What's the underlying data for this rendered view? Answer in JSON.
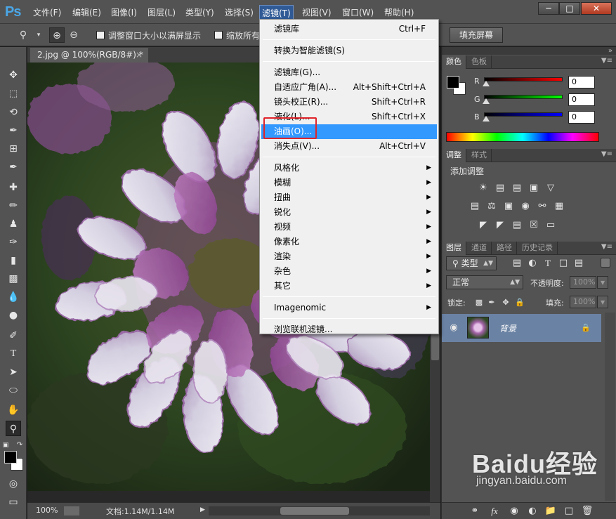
{
  "app": {
    "logo": "Ps"
  },
  "menubar": {
    "items": [
      "文件(F)",
      "编辑(E)",
      "图像(I)",
      "图层(L)",
      "类型(Y)",
      "选择(S)",
      "滤镜(T)",
      "视图(V)",
      "窗口(W)",
      "帮助(H)"
    ],
    "active": "滤镜(T)"
  },
  "window_controls": {
    "minimize": "─",
    "restore": "□",
    "close": "✕"
  },
  "options": {
    "resize_windows_label": "调整窗口大小以满屏显示",
    "zoom_all_label": "缩放所有",
    "fill_screen_label": "填充屏幕"
  },
  "document": {
    "tab_title": "2.jpg @ 100%(RGB/8#) *",
    "tab_close": "×",
    "zoom": "100%",
    "doc_size": "文档:1.14M/1.14M"
  },
  "filter_menu": {
    "items": [
      {
        "label": "滤镜库",
        "shortcut": "Ctrl+F"
      },
      {
        "separator": true
      },
      {
        "label": "转换为智能滤镜(S)"
      },
      {
        "separator": true
      },
      {
        "label": "滤镜库(G)..."
      },
      {
        "label": "自适应广角(A)...",
        "shortcut": "Alt+Shift+Ctrl+A"
      },
      {
        "label": "镜头校正(R)...",
        "shortcut": "Shift+Ctrl+R"
      },
      {
        "label": "液化(L)...",
        "shortcut": "Shift+Ctrl+X"
      },
      {
        "label": "油画(O)...",
        "highlighted": true
      },
      {
        "label": "消失点(V)...",
        "shortcut": "Alt+Ctrl+V"
      },
      {
        "separator": true
      },
      {
        "label": "风格化",
        "submenu": true
      },
      {
        "label": "模糊",
        "submenu": true
      },
      {
        "label": "扭曲",
        "submenu": true
      },
      {
        "label": "锐化",
        "submenu": true
      },
      {
        "label": "视频",
        "submenu": true
      },
      {
        "label": "像素化",
        "submenu": true
      },
      {
        "label": "渲染",
        "submenu": true
      },
      {
        "label": "杂色",
        "submenu": true
      },
      {
        "label": "其它",
        "submenu": true
      },
      {
        "separator": true
      },
      {
        "label": "Imagenomic",
        "submenu": true
      },
      {
        "separator": true
      },
      {
        "label": "浏览联机滤镜..."
      }
    ]
  },
  "color_panel": {
    "tabs": [
      "颜色",
      "色板"
    ],
    "channels": [
      {
        "label": "R",
        "value": "0",
        "color": "#ff0000"
      },
      {
        "label": "G",
        "value": "0",
        "color": "#00ff00"
      },
      {
        "label": "B",
        "value": "0",
        "color": "#0000ff"
      }
    ]
  },
  "adjust_panel": {
    "tabs": [
      "调整",
      "样式"
    ],
    "title": "添加调整",
    "icons": [
      "brightness-icon",
      "levels-icon",
      "curves-icon",
      "exposure-icon",
      "vibrance-icon",
      "hue-saturation-icon",
      "color-balance-icon",
      "black-white-icon",
      "photo-filter-icon",
      "channel-mixer-icon",
      "color-lookup-icon",
      "invert-icon",
      "posterize-icon",
      "threshold-icon",
      "selective-color-icon",
      "gradient-map-icon"
    ]
  },
  "layers_panel": {
    "tabs": [
      "图层",
      "通道",
      "路径",
      "历史记录"
    ],
    "filter_label": "类型",
    "blend_mode": "正常",
    "opacity_label": "不透明度:",
    "opacity_value": "100%",
    "lock_label": "锁定:",
    "fill_label": "填充:",
    "fill_value": "100%",
    "layer_name": "背景"
  },
  "watermark": {
    "logo": "Baidu经验",
    "url": "jingyan.baidu.com"
  },
  "colors": {
    "menu_highlight": "#3399ff",
    "layer_selected": "#6a82a3",
    "annotation": "#e0242a"
  }
}
